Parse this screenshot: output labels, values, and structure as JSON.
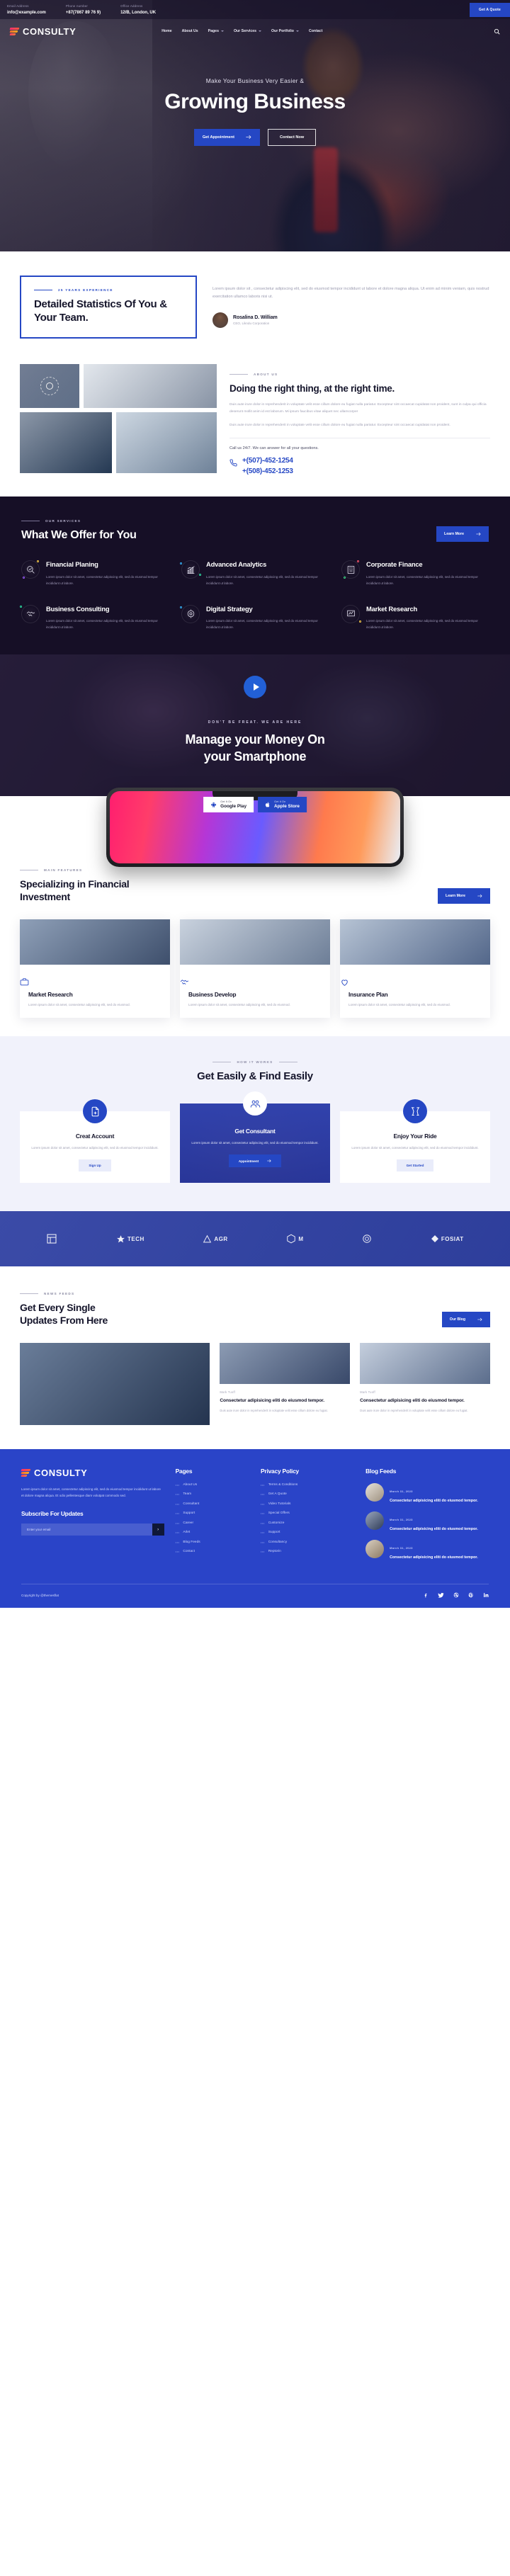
{
  "topbar": {
    "items": [
      {
        "label": "Email Address",
        "value": "info@example.com",
        "icon": "mail-icon"
      },
      {
        "label": "Phone number",
        "value": "+87(7867 89 76 9)",
        "icon": "phone-icon"
      },
      {
        "label": "Office Address",
        "value": "12/B, London, UK",
        "icon": "map-pin-icon"
      }
    ],
    "quote_button": "Get A Quote"
  },
  "nav": {
    "brand": "CONSULTY",
    "menu": [
      {
        "label": "Home",
        "has_dropdown": false
      },
      {
        "label": "About Us",
        "has_dropdown": false
      },
      {
        "label": "Pages",
        "has_dropdown": true
      },
      {
        "label": "Our Services",
        "has_dropdown": true
      },
      {
        "label": "Our Portfolio",
        "has_dropdown": true
      },
      {
        "label": "Contact",
        "has_dropdown": false
      }
    ],
    "search_icon": "search-icon"
  },
  "hero": {
    "subtitle": "Make Your Business Very Easier &",
    "title": "Growing Business",
    "primary_button": "Get Appointment",
    "outline_button": "Contact Now"
  },
  "stats": {
    "eyebrow": "25 YEARS EXPERIENCE",
    "title": "Detailed Statistics Of You & Your Team.",
    "paragraph": "Lorem ipsum dolor sit , consectetur adipiscing elit, sed do eiusmod tempor incididunt ut labore et dolore magna aliqua. Ut enim ad minim veniam, quis nostrud exercitation ullamco laboris nisi ut.",
    "author_name": "Rosalina D. William",
    "author_role": "CEO, Likndu Corporation"
  },
  "about": {
    "eyebrow": "ABOUT US",
    "title": "Doing the right thing, at the right time.",
    "paragraph1": "Duis aute irure dolor in reprehenderit in voluptate velit esse cillum dolore eu fugiat nulla pariatur. Excepteur sint occaecat cupidatat non proident, sunt in culpa qui officia deserunt mollit anim id est laborum. Mi ipsum faucibus vitae aliquet nec ullamcorper",
    "paragraph2": "Duis aute irure dolor in reprehenderit in voluptate velit esse cillum dolore eu fugiat nulla pariatur. Excepteur sint occaecat cupidatat non proident.",
    "call_line": "Call us 24/7. We can answer for all your questions.",
    "phone1": "+(507)-452-1254",
    "phone2": "+(508)-452-1253"
  },
  "services": {
    "eyebrow": "OUR SERVICES",
    "title": "What We Offer for You",
    "learn_more": "Learn More",
    "items": [
      {
        "name": "Financial Planing",
        "icon": "magnifier-check-icon",
        "desc": "Lorem ipsum dolor sit amet, consectetur adipiscing elit, sed do eiusmod tempor incididunt ut labore."
      },
      {
        "name": "Advanced Analytics",
        "icon": "bar-chart-growth-icon",
        "desc": "Lorem ipsum dolor sit amet, consectetur adipiscing elit, sed do eiusmod tempor incididunt ut labore."
      },
      {
        "name": "Corporate Finance",
        "icon": "building-icon",
        "desc": "Lorem ipsum dolor sit amet, consectetur adipiscing elit, sed do eiusmod tempor incididunt ut labore."
      },
      {
        "name": "Business Consulting",
        "icon": "handshake-icon",
        "desc": "Lorem ipsum dolor sit amet, consectetur adipiscing elit, sed do eiusmod tempor incididunt ut labore."
      },
      {
        "name": "Digital Strategy",
        "icon": "strategy-icon",
        "desc": "Lorem ipsum dolor sit amet, consectetur adipiscing elit, sed do eiusmod tempor incididunt ut labore."
      },
      {
        "name": "Market Research",
        "icon": "research-icon",
        "desc": "Lorem ipsum dolor sit amet, consectetur adipiscing elit, sed do eiusmod tempor incididunt ut labore."
      }
    ]
  },
  "video_cta": {
    "play_icon": "play-icon",
    "eyebrow": "DON'T BE FREAT. WE ARE HERE",
    "title_line1": "Manage your Money On",
    "title_line2": "your Smartphone",
    "store_google_top": "Get It On",
    "store_google_bottom": "Google Play",
    "store_apple_top": "Get It On",
    "store_apple_bottom": "Apple Store"
  },
  "features": {
    "eyebrow": "MAIN FEATURES",
    "title_line1": "Specializing in Financial",
    "title_line2": "Investment",
    "learn_more": "Learn More",
    "cards": [
      {
        "name": "Market Research",
        "icon": "briefcase-icon",
        "desc": "Lorem ipsum dolor sit amet, consectetur adipiscing elit, sed do eiusmod."
      },
      {
        "name": "Business Develop",
        "icon": "handshake-icon",
        "desc": "Lorem ipsum dolor sit amet, consectetur adipiscing elit, sed do eiusmod."
      },
      {
        "name": "Insurance Plan",
        "icon": "heart-shield-icon",
        "desc": "Lorem ipsum dolor sit amet, consectetur adipiscing elit, sed do eiusmod."
      }
    ]
  },
  "how_it_works": {
    "eyebrow": "HOW IT WORKS",
    "title": "Get Easily & Find Easily",
    "steps": [
      {
        "name": "Creat Account",
        "icon": "file-plus-icon",
        "desc": "Lorem ipsum dolor sit amet, consectetur adipiscing elit, sed do eiusmod tempor incididunt.",
        "button": "Sign Up",
        "active": false
      },
      {
        "name": "Get Consultant",
        "icon": "team-icon",
        "desc": "Lorem ipsum dolor sit amet, consectetur adipiscing elit, sed do eiusmod tempor incididunt.",
        "button": "Appointment",
        "active": true
      },
      {
        "name": "Enjoy Your Ride",
        "icon": "cheers-icon",
        "desc": "Lorem ipsum dolor sit amet, consectetur adipiscing elit, sed do eiusmod tempor incididunt.",
        "button": "Get Started",
        "active": false
      }
    ]
  },
  "brands": [
    {
      "name": "logoipsum-box-icon",
      "label": ""
    },
    {
      "name": "tech-logo",
      "label": "TECH"
    },
    {
      "name": "agr-logo",
      "label": "AGR"
    },
    {
      "name": "m-monogram-logo",
      "label": "M"
    },
    {
      "name": "circle-logo",
      "label": ""
    },
    {
      "name": "fosiat-logo",
      "label": "FOSIAT"
    }
  ],
  "news": {
    "eyebrow": "NEWS FEEDS",
    "title_line1": "Get Every Single",
    "title_line2": "Updates From Here",
    "button": "Our Blog",
    "cards": [
      {
        "meta": "Mark Tuoff",
        "heading": "Consectetur adipisicing eliti do eiusmod tempor.",
        "desc": "Duis aute irure dolor in reprehenderit in voluptate velit esse cillum dolore eu fugiat."
      },
      {
        "meta": "Mark Tuoff",
        "heading": "Consectetur adipisicing eliti do eiusmod tempor.",
        "desc": "Duis aute irure dolor in reprehenderit in voluptate velit esse cillum dolore eu fugiat."
      }
    ]
  },
  "footer": {
    "brand": "CONSULTY",
    "about": "Lorem ipsum dolor sit amet, consectetur adipiscing elit, sed do eiusmod tempor incididunt ut labore et dolore magna aliqua. Et odio pellentesque diam volutpat commodo sed.",
    "subscribe_title": "Subscribe For Updates",
    "subscribe_placeholder": "Enter your email",
    "subscribe_button_icon": "chevron-right-icon",
    "columns": [
      {
        "title": "Pages",
        "links": [
          "About Us",
          "Team",
          "Consultant",
          "Support",
          "Career",
          "Arlet",
          "Blog Feeds",
          "Contact"
        ]
      },
      {
        "title": "Privacy Policy",
        "links": [
          "Terms & Conditions",
          "Get A Quote",
          "Video Tutorials",
          "Special Offers",
          "Customize",
          "Support",
          "Consultancy",
          "Reptorin"
        ]
      }
    ],
    "blog_title": "Blog Feeds",
    "blog_items": [
      {
        "date": "March 31, 2023",
        "text": "Consectetur adipisicing eliti do eiusmod tempor."
      },
      {
        "date": "March 31, 2023",
        "text": "Consectetur adipisicing eliti do eiusmod tempor."
      },
      {
        "date": "March 31, 2023",
        "text": "Consectetur adipisicing eliti do eiusmod tempor."
      }
    ],
    "copyright": "Copyright by @themesflat",
    "socials": [
      {
        "name": "facebook-icon",
        "glyph": "f"
      },
      {
        "name": "twitter-icon",
        "glyph": "✦"
      },
      {
        "name": "dribbble-icon",
        "glyph": "⬤"
      },
      {
        "name": "pinterest-icon",
        "glyph": "℗"
      },
      {
        "name": "linkedin-icon",
        "glyph": "in"
      }
    ]
  },
  "colors": {
    "brand_blue": "#2547c4",
    "footer_blue": "#2a44c8",
    "dark_purple": "#160f26",
    "light_lavender": "#f1f2fb"
  }
}
